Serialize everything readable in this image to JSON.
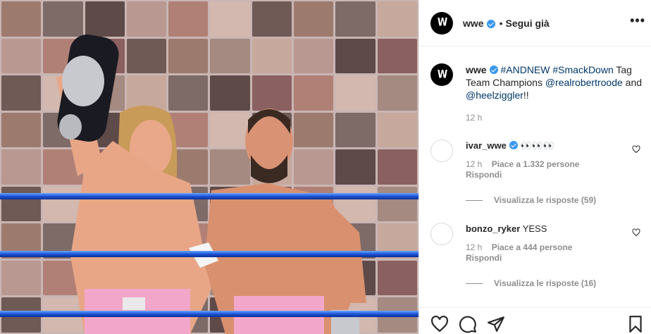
{
  "post": {
    "username": "wwe",
    "follow_state": "Segui già",
    "more": "•••",
    "separator": "•"
  },
  "caption": {
    "username": "wwe",
    "hashtag1": "#ANDNEW",
    "hashtag2": "#SmackDown",
    "text1": " Tag Team Champions ",
    "mention1": "@realrobertroode",
    "text2": " and ",
    "mention2": "@heelziggler",
    "text3": "!!",
    "time": "12 h"
  },
  "comments": [
    {
      "username": "ivar_wwe",
      "text": "👀👀👀",
      "time": "12 h",
      "likes": "Piace a 1.332 persone",
      "reply": "Rispondi",
      "view_replies": "Visualizza le risposte (59)"
    },
    {
      "username": "bonzo_ryker",
      "text": "YESS",
      "time": "12 h",
      "likes": "Piace a 444 persone",
      "reply": "Rispondi",
      "view_replies": "Visualizza le risposte (16)"
    }
  ],
  "colors": {
    "verified": "#3897f0",
    "link": "#00376b",
    "muted": "#8e8e8e",
    "rope": "#1d55d8",
    "trunks": "#f2a6c9"
  },
  "icons": [
    "wwe-logo-icon",
    "verified-badge-icon",
    "heart-icon",
    "comment-icon",
    "share-icon",
    "bookmark-icon",
    "more-options-icon"
  ]
}
